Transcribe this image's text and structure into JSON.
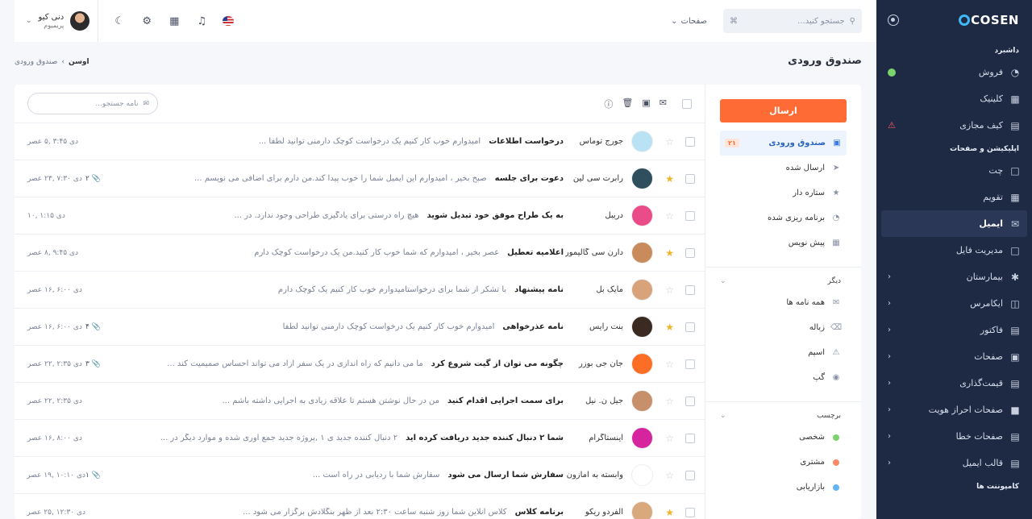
{
  "brand": {
    "logo": "COSEN"
  },
  "sidebar": {
    "sections": [
      {
        "title": "داشبرد",
        "items": [
          {
            "label": "فروش",
            "icon": "dashboard-icon",
            "badge": "dot"
          },
          {
            "label": "کلینیک",
            "icon": "clinic-icon"
          },
          {
            "label": "کیف مجازی",
            "icon": "wallet-icon",
            "badge": "warn"
          }
        ]
      },
      {
        "title": "اپلیکیشن و صفحات",
        "items": [
          {
            "label": "چت",
            "icon": "chat-icon"
          },
          {
            "label": "تقویم",
            "icon": "calendar-icon"
          },
          {
            "label": "ایمیل",
            "icon": "mail-icon",
            "active": true
          },
          {
            "label": "مدیریت فایل",
            "icon": "folder-icon"
          },
          {
            "label": "بیمارستان",
            "icon": "hospital-icon",
            "chevron": true
          },
          {
            "label": "ایکامرس",
            "icon": "basket-icon",
            "chevron": true
          },
          {
            "label": "فاکتور",
            "icon": "invoice-icon",
            "chevron": true
          },
          {
            "label": "صفحات",
            "icon": "pages-icon",
            "chevron": true
          },
          {
            "label": "قیمت‌گذاری",
            "icon": "pricing-icon",
            "chevron": true
          },
          {
            "label": "صفحات احراز هویت",
            "icon": "lock-icon",
            "chevron": true
          },
          {
            "label": "صفحات خطا",
            "icon": "error-icon",
            "chevron": true
          },
          {
            "label": "قالب ایمیل",
            "icon": "template-icon",
            "chevron": true
          }
        ]
      },
      {
        "title": "کامپوننت ها",
        "items": []
      }
    ]
  },
  "header": {
    "search_placeholder": "جستجو کنید...",
    "pages_label": "صفحات",
    "user_name": "دنی کیو",
    "user_role": "پریمیوم"
  },
  "page": {
    "title": "صندوق ورودی"
  },
  "breadcrumb": {
    "home": "اوسن",
    "sep": "›",
    "current": "صندوق ورودی"
  },
  "mailnav": {
    "send_label": "ارسال",
    "folders": [
      {
        "label": "صندوق ورودی",
        "count": "۲۱",
        "active": true,
        "icon": "inbox-icon"
      },
      {
        "label": "ارسال شده",
        "icon": "send-icon"
      },
      {
        "label": "ستاره دار",
        "icon": "star-icon"
      },
      {
        "label": "برنامه ریزی شده",
        "icon": "clock-icon"
      },
      {
        "label": "پیش نویس",
        "icon": "draft-icon"
      }
    ],
    "other_title": "دیگر",
    "other": [
      {
        "label": "همه نامه ها",
        "icon": "all-mail-icon"
      },
      {
        "label": "زباله",
        "icon": "trash-icon"
      },
      {
        "label": "اسپم",
        "icon": "spam-icon"
      },
      {
        "label": "گپ",
        "icon": "chat-bubble-icon"
      }
    ],
    "labels_title": "برچسب",
    "labels": [
      {
        "label": "شخصی",
        "color": "#7ad36b"
      },
      {
        "label": "مشتری",
        "color": "#ff8a65"
      },
      {
        "label": "بازاریابی",
        "color": "#64b5f6"
      }
    ]
  },
  "maillist": {
    "search_placeholder": "نامه جستجو...",
    "rows": [
      {
        "sender": "جورج توماس",
        "subject": "درخواست اطلاعات",
        "preview": "امیدوارم خوب کار کنیم یک درخواست کوچک دارمنی توانید لطفا ...",
        "attach": "",
        "date": "دی ۳:۴۵ ,۵ عصر",
        "starred": false,
        "avatar_color": "#b9e3f5"
      },
      {
        "sender": "رابرت سی لین",
        "subject": "دعوت برای جلسه",
        "preview": "صبح بخیر ، امیدوارم این ایمیل شما را خوب پیدا کند.من دارم برای اضافی می نویسم ...",
        "attach": "۲",
        "date": "دی ۷:۳۰ ,۲۳ عصر",
        "starred": true,
        "avatar_color": "#2f4f5f"
      },
      {
        "sender": "دریبل",
        "subject": "به یک طراح موفق خود تبدیل شوید",
        "preview": "هیچ راه درستی برای یادگیری طراحی وجود ندارد. در ...",
        "attach": "",
        "date": "دی ۱:۱۵ ,۱۰",
        "starred": false,
        "avatar_color": "#ea4c89"
      },
      {
        "sender": "دارن سی گالیمور",
        "subject": "اعلامیه تعطیل",
        "preview": "عصر بخیر ، امیدوارم که شما خوب کار کنید.من یک درخواست کوچک دارم",
        "attach": "",
        "date": "دی ۹:۴۵ ,۸ عصر",
        "starred": true,
        "avatar_color": "#c98b5c"
      },
      {
        "sender": "مایک بل",
        "subject": "نامه پیشنهاد",
        "preview": "با تشکر از شما برای درخواستامیدوارم خوب کار کنیم یک کوچک دارم",
        "attach": "",
        "date": "دی ۶:۰۰ ,۱۶ عصر",
        "starred": false,
        "avatar_color": "#d8a27a"
      },
      {
        "sender": "بنت رایس",
        "subject": "نامه عذرخواهی",
        "preview": "امیدوارم خوب کار کنیم یک درخواست کوچک دارمنی توانید لطفا",
        "attach": "۴",
        "date": "دی ۶:۰۰ ,۱۶ عصر",
        "starred": true,
        "avatar_color": "#3a2a22"
      },
      {
        "sender": "جان جی بوزر",
        "subject": "چگونه می توان از گیت شروع کرد",
        "preview": "ما می دانیم که راه اندازی در یک سفر آزاد می تواند احساس صمیمیت کند ...",
        "attach": "۳",
        "date": "دی ۲:۳۵ ,۲۲ عصر",
        "starred": false,
        "avatar_color": "#fc6d26"
      },
      {
        "sender": "جیل ن. نیل",
        "subject": "برای سمت اجرایی اقدام کنید",
        "preview": "من در حال نوشتن هستم تا علاقه زیادی به اجرایی داشته باشم ...",
        "attach": "",
        "date": "دی ۲:۳۵ ,۲۲ عصر",
        "starred": false,
        "avatar_color": "#c7906a"
      },
      {
        "sender": "اینستاگرام",
        "subject": "شما ۲ دنبال کننده جدید دریافت کرده اید",
        "preview": "۲ دنبال کننده جدید ی ۱ ,پروژه جدید جمع آوری شده و موارد دیگر در ...",
        "attach": "",
        "date": "دی ۸:۰۰ ,۱۶ عصر",
        "starred": false,
        "avatar_color": "#d6249f"
      },
      {
        "sender": "وابسته به آمازون",
        "subject": "سفارش شما ارسال می شود",
        "preview": "سفارش شما با ردیابی در راه است ...",
        "attach": "۱",
        "date": "دی ۱۰:۱۰ ,۱۹ عصر",
        "starred": false,
        "avatar_color": "#ffffff"
      },
      {
        "sender": "آلفردو ریکو",
        "subject": "برنامه کلاس",
        "preview": "کلاس آنلاین شما روز شنبه ساعت ۲:۳۰ بعد از ظهر بنگلادش برگزار می شود ...",
        "attach": "",
        "date": "دی ۱۲:۳۰ ,۲۵ عصر",
        "starred": true,
        "avatar_color": "#d9a87c"
      }
    ]
  }
}
